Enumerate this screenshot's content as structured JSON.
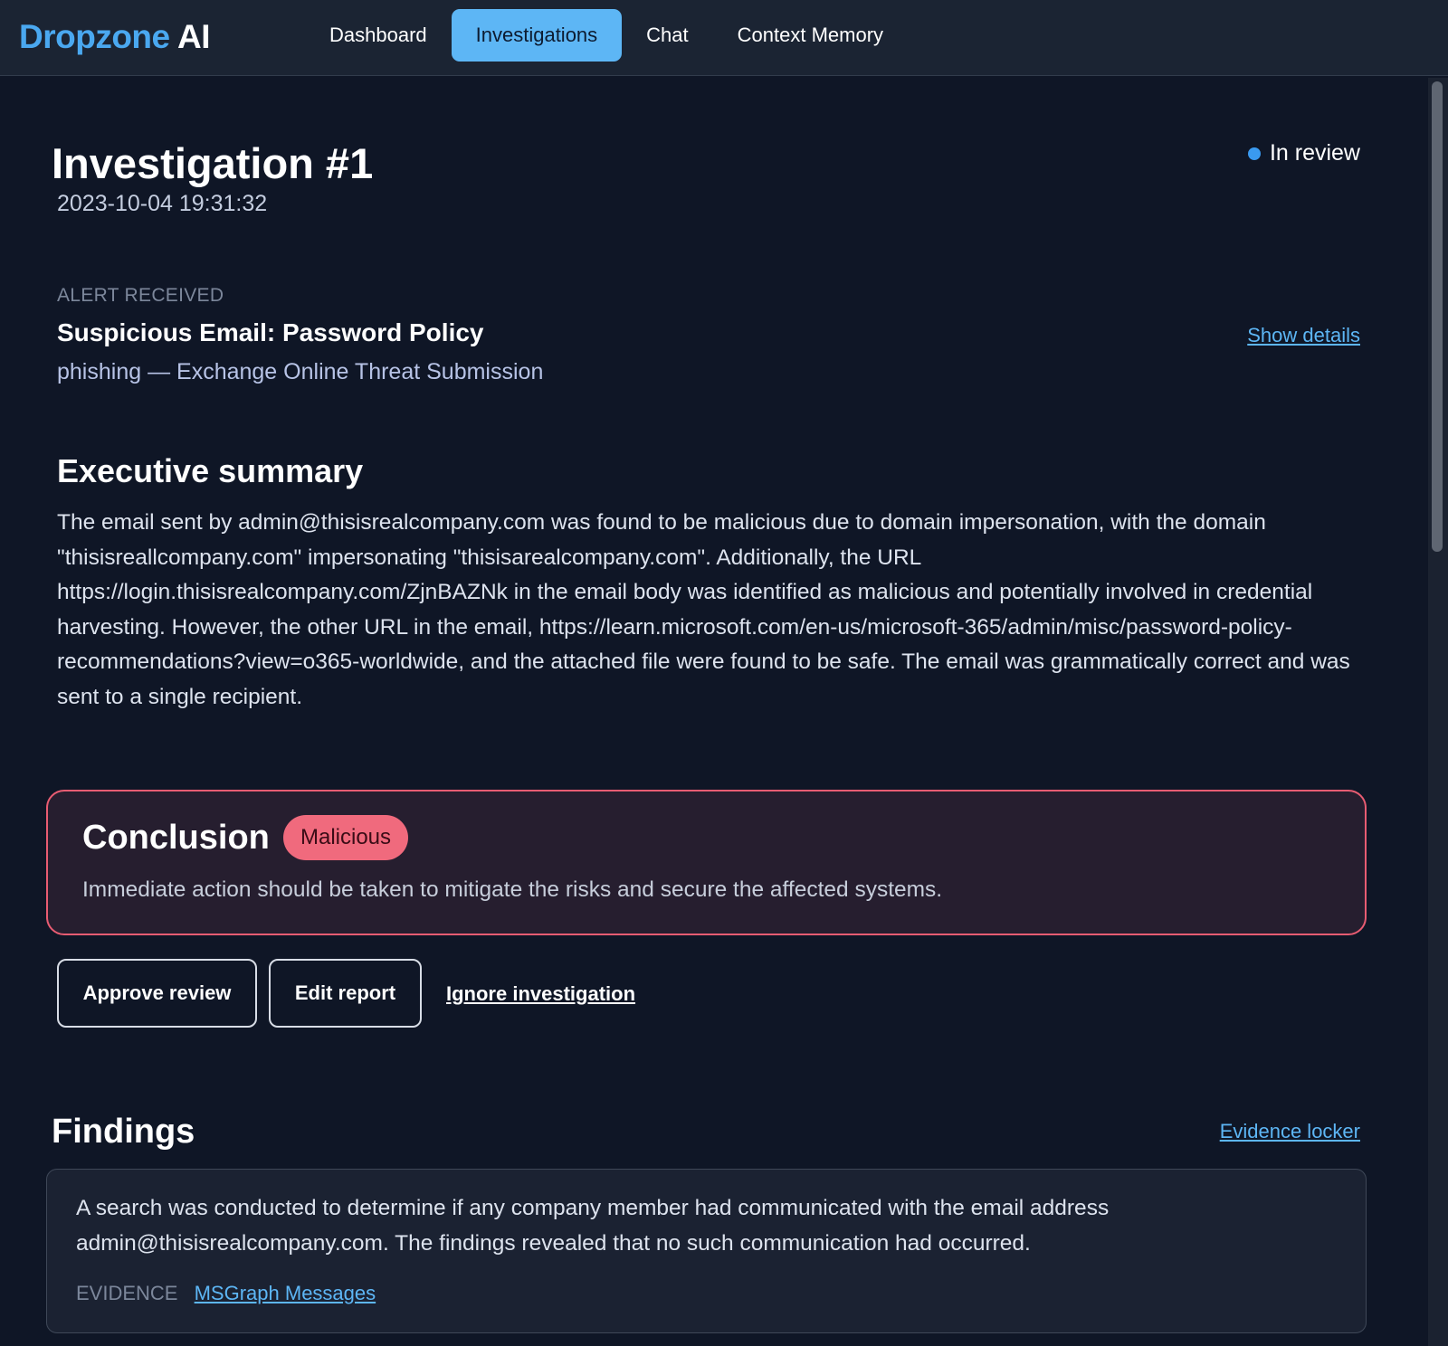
{
  "header": {
    "brand": "Dropzone",
    "brand_suffix": "AI",
    "nav": [
      {
        "label": "Dashboard",
        "active": false
      },
      {
        "label": "Investigations",
        "active": true
      },
      {
        "label": "Chat",
        "active": false
      },
      {
        "label": "Context Memory",
        "active": false
      }
    ]
  },
  "investigation": {
    "title": "Investigation #1",
    "timestamp": "2023-10-04 19:31:32",
    "status": "In review",
    "status_color": "#3a9af0"
  },
  "alert": {
    "label": "ALERT RECEIVED",
    "title": "Suspicious Email: Password Policy",
    "subtitle": "phishing — Exchange Online Threat Submission",
    "details_link": "Show details"
  },
  "executive_summary": {
    "title": "Executive summary",
    "text": "The email sent by admin@thisisrealcompany.com was found to be malicious due to domain impersonation, with the domain \"thisisreallcompany.com\" impersonating \"thisisarealcompany.com\". Additionally, the URL https://login.thisisrealcompany.com/ZjnBAZNk in the email body was identified as malicious and potentially involved in credential harvesting. However, the other URL in the email, https://learn.microsoft.com/en-us/microsoft-365/admin/misc/password-policy-recommendations?view=o365-worldwide, and the attached file were found to be safe. The email was grammatically correct and was sent to a single recipient."
  },
  "conclusion": {
    "title": "Conclusion",
    "verdict": "Malicious",
    "verdict_color": "#f06a7d",
    "text": "Immediate action should be taken to mitigate the risks and secure the affected systems."
  },
  "actions": {
    "approve": "Approve review",
    "edit": "Edit report",
    "ignore": "Ignore investigation"
  },
  "findings": {
    "title": "Findings",
    "evidence_locker_link": "Evidence locker",
    "items": [
      {
        "text": "A search was conducted to determine if any company member had communicated with the email address admin@thisisrealcompany.com. The findings revealed that no such communication had occurred.",
        "evidence_label": "EVIDENCE",
        "evidence_link": "MSGraph Messages"
      }
    ]
  }
}
